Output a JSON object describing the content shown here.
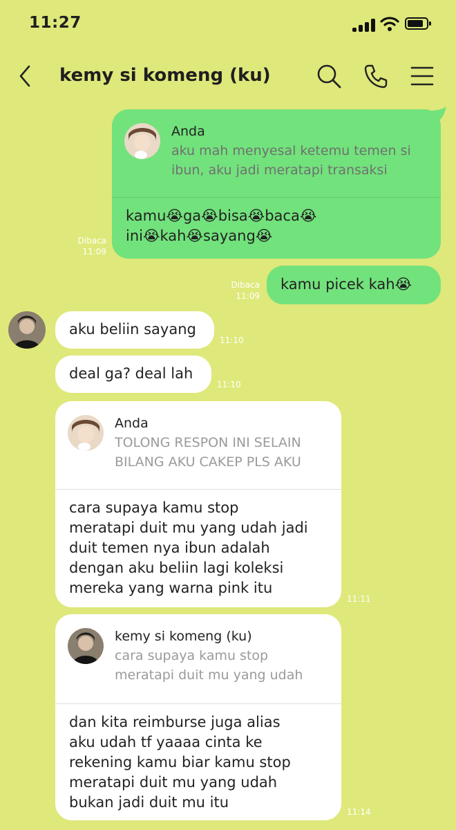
{
  "status_bar": {
    "time": "11:27"
  },
  "header": {
    "title": "kemy si komeng (ku)"
  },
  "messages": [
    {
      "quote": {
        "name": "Anda",
        "text": "aku mah menyesal ketemu temen si\nibun, aku jadi meratapi transaksi"
      },
      "text": "kamu😭ga😭bisa😭baca😭\nini😭kah😭sayang😭",
      "read": "Dibaca",
      "time": "11:09"
    },
    {
      "text": "kamu picek kah😭",
      "read": "Dibaca",
      "time": "11:09"
    },
    {
      "text": "aku beliin sayang",
      "time": "11:10"
    },
    {
      "text": "deal ga? deal lah",
      "time": "11:10"
    },
    {
      "quote": {
        "name": "Anda",
        "text": "TOLONG RESPON INI SELAIN\nBILANG AKU CAKEP PLS AKU"
      },
      "text": "cara supaya kamu stop\nmeratapi duit mu yang udah jadi\nduit temen nya ibun adalah\ndengan aku beliin lagi koleksi\nmereka yang warna pink itu",
      "time": "11:11"
    },
    {
      "quote": {
        "name": "kemy si komeng (ku)",
        "text": "cara supaya kamu stop\nmeratapi duit mu yang udah"
      },
      "text": "dan kita reimburse juga alias\naku udah tf yaaaa cinta ke\nrekening kamu biar kamu stop\nmeratapi duit mu yang udah\nbukan jadi duit mu itu",
      "time": "11:14"
    }
  ],
  "colors": {
    "background": "#dfe87a",
    "outgoing": "#72e27c",
    "incoming": "#ffffff"
  }
}
